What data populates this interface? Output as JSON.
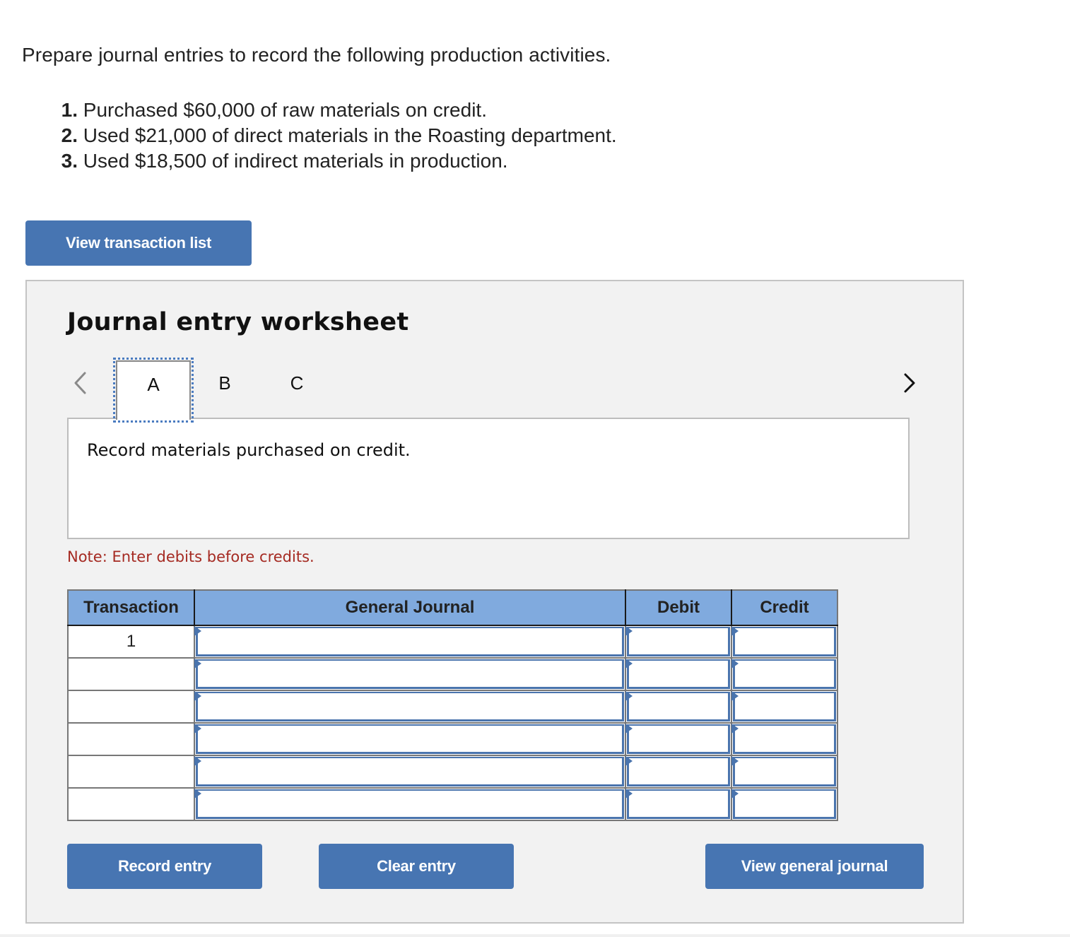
{
  "prompt": "Prepare journal entries to record the following production activities.",
  "steps": [
    {
      "num": "1.",
      "text": "Purchased $60,000 of raw materials on credit."
    },
    {
      "num": "2.",
      "text": "Used $21,000 of direct materials in the Roasting department."
    },
    {
      "num": "3.",
      "text": "Used $18,500 of indirect materials in production."
    }
  ],
  "buttons": {
    "view_transaction_list": "View transaction list",
    "record_entry": "Record entry",
    "clear_entry": "Clear entry",
    "view_general_journal": "View general journal"
  },
  "worksheet": {
    "title": "Journal entry worksheet",
    "nav": {
      "prev_icon": "chevron-left-icon",
      "next_icon": "chevron-right-icon"
    },
    "tabs": [
      {
        "label": "A",
        "active": true
      },
      {
        "label": "B",
        "active": false
      },
      {
        "label": "C",
        "active": false
      }
    ],
    "description": "Record materials purchased on credit.",
    "note": "Note: Enter debits before credits.",
    "table": {
      "headers": [
        "Transaction",
        "General Journal",
        "Debit",
        "Credit"
      ],
      "rows": [
        {
          "transaction": "1",
          "account": "",
          "debit": "",
          "credit": ""
        },
        {
          "transaction": "",
          "account": "",
          "debit": "",
          "credit": ""
        },
        {
          "transaction": "",
          "account": "",
          "debit": "",
          "credit": ""
        },
        {
          "transaction": "",
          "account": "",
          "debit": "",
          "credit": ""
        },
        {
          "transaction": "",
          "account": "",
          "debit": "",
          "credit": ""
        },
        {
          "transaction": "",
          "account": "",
          "debit": "",
          "credit": ""
        }
      ]
    }
  },
  "colors": {
    "button": "#4775b2",
    "table_header": "#80aade",
    "note": "#a52a22",
    "panel_bg": "#f2f2f2",
    "input_border": "#4a74ad"
  }
}
